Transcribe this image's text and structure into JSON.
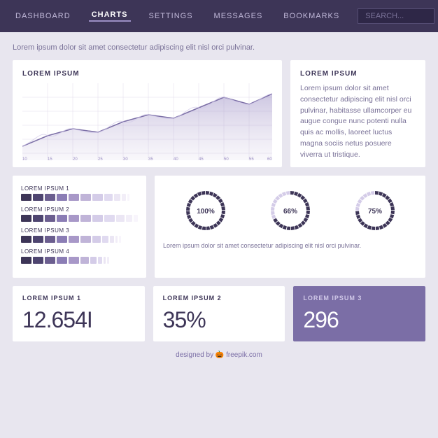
{
  "nav": {
    "items": [
      {
        "label": "DASHBOARD",
        "active": false
      },
      {
        "label": "CHARTS",
        "active": true
      },
      {
        "label": "SETTINGS",
        "active": false
      },
      {
        "label": "MESSAGES",
        "active": false
      },
      {
        "label": "BOOKMARKS",
        "active": false
      }
    ],
    "search_placeholder": "SEARCH..."
  },
  "intro": "Lorem ipsum dolor sit amet consectetur adipiscing elit nisl orci pulvinar.",
  "chart_card": {
    "title": "LOREM IPSUM",
    "x_labels": [
      "10",
      "15",
      "20",
      "25",
      "30",
      "35",
      "40",
      "45",
      "50",
      "55",
      "60"
    ]
  },
  "desc_card": {
    "title": "LOREM IPSUM",
    "text": "Lorem ipsum dolor sit amet consectetur adipiscing elit nisl orci pulvinar, habitasse ullamcorper eu augue congue nunc potenti nulla quis ac mollis, laoreet luctus magna sociis netus posuere viverra ut tristique."
  },
  "bar_card": {
    "items": [
      {
        "label": "LOREM IPSUM 1",
        "segments": [
          5,
          5,
          5,
          5,
          5,
          5,
          5,
          4,
          3,
          2,
          1
        ]
      },
      {
        "label": "LOREM IPSUM 2",
        "segments": [
          5,
          5,
          5,
          5,
          5,
          5,
          5,
          5,
          4,
          3,
          2
        ]
      },
      {
        "label": "LOREM IPSUM 3",
        "segments": [
          5,
          5,
          5,
          5,
          5,
          5,
          4,
          3,
          2,
          1,
          1
        ]
      },
      {
        "label": "LOREM IPSUM 4",
        "segments": [
          5,
          5,
          5,
          5,
          5,
          4,
          3,
          2,
          1,
          1,
          0
        ]
      }
    ]
  },
  "donut_card": {
    "donuts": [
      {
        "pct": 100,
        "label": "100%"
      },
      {
        "pct": 66,
        "label": "66%"
      },
      {
        "pct": 75,
        "label": "75%"
      }
    ],
    "desc": "Lorem ipsum dolor sit amet consectetur adipiscing elit nisl orci pulvinar."
  },
  "stats": [
    {
      "title": "LOREM IPSUM 1",
      "value": "12.654I",
      "purple": false
    },
    {
      "title": "LOREM IPSUM 2",
      "value": "35%",
      "purple": false
    },
    {
      "title": "LOREM IPSUM 3",
      "value": "296",
      "purple": true
    }
  ],
  "footer": {
    "text": "designed by",
    "brand": "🎃 freepik.com"
  },
  "colors": {
    "dark_purple": "#3d3557",
    "mid_purple": "#7b6ea6",
    "light_purple": "#c0b4d8",
    "faint_purple": "#e0daea"
  }
}
